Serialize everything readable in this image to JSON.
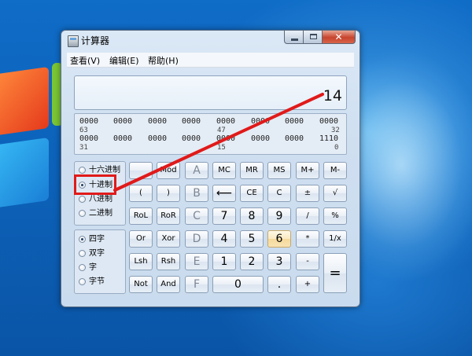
{
  "window": {
    "title": "计算器"
  },
  "menu": [
    "查看(V)",
    "编辑(E)",
    "帮助(H)"
  ],
  "display": {
    "value": "14"
  },
  "bits": {
    "row1": [
      "0000",
      "0000",
      "0000",
      "0000",
      "0000",
      "0000",
      "0000",
      "0000"
    ],
    "row1_idx": [
      "63",
      "47",
      "32"
    ],
    "row2": [
      "0000",
      "0000",
      "0000",
      "0000",
      "0000",
      "0000",
      "0000",
      "1110"
    ],
    "row2_idx": [
      "31",
      "15",
      "0"
    ]
  },
  "base_radios": [
    {
      "label": "十六进制",
      "selected": false
    },
    {
      "label": "十进制",
      "selected": true
    },
    {
      "label": "八进制",
      "selected": false
    },
    {
      "label": "二进制",
      "selected": false
    }
  ],
  "word_radios": [
    {
      "label": "四字",
      "selected": true
    },
    {
      "label": "双字",
      "selected": false
    },
    {
      "label": "字",
      "selected": false
    },
    {
      "label": "字节",
      "selected": false
    }
  ],
  "keys": {
    "r1": [
      "",
      "Mod",
      "A",
      "MC",
      "MR",
      "MS",
      "M+",
      "M-"
    ],
    "r2": [
      "(",
      ")",
      "B",
      "⟵",
      "CE",
      "C",
      "±",
      "√"
    ],
    "r3": [
      "RoL",
      "RoR",
      "C",
      "7",
      "8",
      "9",
      "/",
      "%"
    ],
    "r4": [
      "Or",
      "Xor",
      "D",
      "4",
      "5",
      "6",
      "*",
      "1/x"
    ],
    "r5": [
      "Lsh",
      "Rsh",
      "E",
      "1",
      "2",
      "3",
      "-",
      "="
    ],
    "r6": [
      "Not",
      "And",
      "F",
      "0",
      ".",
      "+"
    ]
  },
  "annotation": {
    "color": "#e01a1a"
  }
}
